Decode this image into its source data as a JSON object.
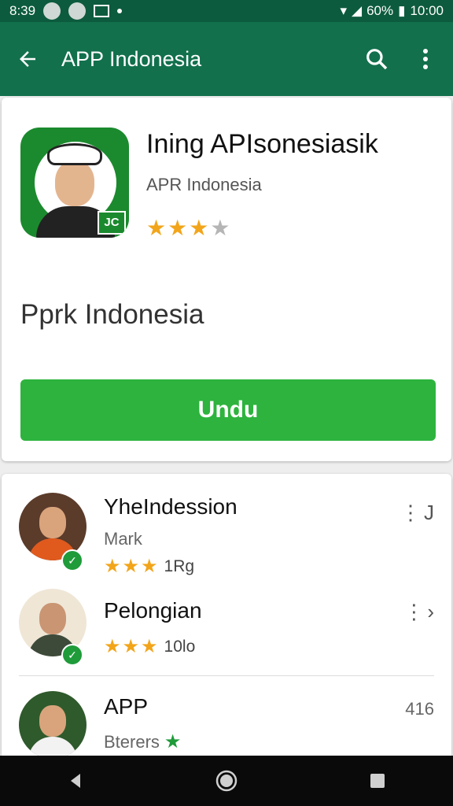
{
  "statusbar": {
    "time_left": "8:39",
    "battery": "60%",
    "time_right": "10:00"
  },
  "appbar": {
    "title": "APP Indonesia",
    "back_icon": "back-arrow-icon",
    "search_icon": "search-icon",
    "menu_icon": "more-vert-icon"
  },
  "app": {
    "title": "Ining APIsonesiasik",
    "developer": "APR Indonesia",
    "rating_stars": 3,
    "badge_text": "JC",
    "subtitle": "Pprk Indonesia",
    "install_label": "Undu"
  },
  "list": [
    {
      "title": "YheIndession",
      "subtitle": "Mark",
      "stars": 3,
      "count": "1Rg",
      "more": "J"
    },
    {
      "title": "Pelongian",
      "subtitle": "",
      "stars": 3,
      "count": "10lo",
      "more": "›"
    },
    {
      "title": "APP",
      "subtitle": "Bterers",
      "stars": 1,
      "count": "",
      "more": "416"
    }
  ],
  "colors": {
    "statusbar": "#0d5b3e",
    "appbar": "#12704d",
    "install": "#2db33e",
    "star": "#f2a51a"
  }
}
